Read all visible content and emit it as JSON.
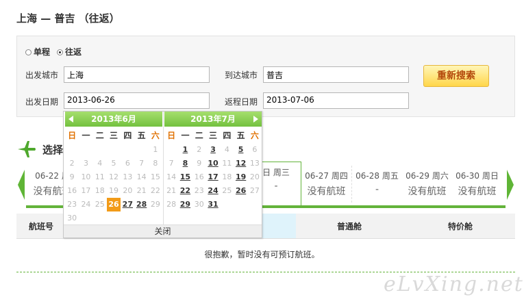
{
  "route_title": "上海 — 普吉 （往返）",
  "trip_type": {
    "one_way": "单程",
    "round_trip": "往返",
    "selected": "往返"
  },
  "form": {
    "depart_city_label": "出发城市",
    "depart_city_value": "上海",
    "arrive_city_label": "到达城市",
    "arrive_city_value": "普吉",
    "depart_date_label": "出发日期",
    "depart_date_value": "2013-06-26",
    "return_date_label": "返程日期",
    "return_date_value": "2013-07-06",
    "research_button": "重新搜索"
  },
  "select_heading": "选择",
  "date_strip": [
    {
      "date": "06-22 周",
      "status": "没有航班"
    },
    {
      "date": "",
      "status": ""
    },
    {
      "date": "",
      "status": ""
    },
    {
      "date": "",
      "status": ""
    },
    {
      "date": "日 周三",
      "status": "-"
    },
    {
      "date": "06-27 周四",
      "status": "没有航班"
    },
    {
      "date": "06-28 周五",
      "status": "-"
    },
    {
      "date": "06-29 周六",
      "status": "没有航班"
    },
    {
      "date": "06-30 周日",
      "status": "没有航班"
    }
  ],
  "list_header": {
    "flight_no": "航班号",
    "economy": "普通舱",
    "special": "特价舱"
  },
  "no_flight_message": "很抱歉，暂时没有可预订航班。",
  "watermark": "eLvXing.net",
  "calendar": {
    "weekdays": [
      "日",
      "一",
      "二",
      "三",
      "四",
      "五",
      "六"
    ],
    "months": [
      {
        "title": "2013年6月",
        "days": [
          "",
          "",
          "",
          "",
          "",
          "",
          "1",
          "2",
          "3",
          "4",
          "5",
          "6",
          "7",
          "8",
          "9",
          "10",
          "11",
          "12",
          "13",
          "14",
          "15",
          "16",
          "17",
          "18",
          "19",
          "20",
          "21",
          "22",
          "23",
          "24",
          "25",
          "26",
          "27",
          "28",
          "29",
          "30"
        ],
        "available": [
          "26",
          "27",
          "28"
        ],
        "selected": "26"
      },
      {
        "title": "2013年7月",
        "days": [
          "",
          "1",
          "2",
          "3",
          "4",
          "5",
          "6",
          "7",
          "8",
          "9",
          "10",
          "11",
          "12",
          "13",
          "14",
          "15",
          "16",
          "17",
          "18",
          "19",
          "20",
          "21",
          "22",
          "23",
          "24",
          "25",
          "26",
          "27",
          "28",
          "29",
          "30",
          "31"
        ],
        "available": [
          "1",
          "3",
          "5",
          "8",
          "10",
          "12",
          "15",
          "17",
          "19",
          "22",
          "24",
          "26",
          "29",
          "31"
        ],
        "selected": ""
      }
    ],
    "close_label": "关闭"
  },
  "colors": {
    "green": "#63b33a",
    "orange": "#f29b18",
    "button_text": "#b3480b"
  },
  "icons": [
    "plane-icon",
    "arrow-left-icon",
    "arrow-right-icon",
    "calendar-prev-icon",
    "calendar-next-icon"
  ]
}
